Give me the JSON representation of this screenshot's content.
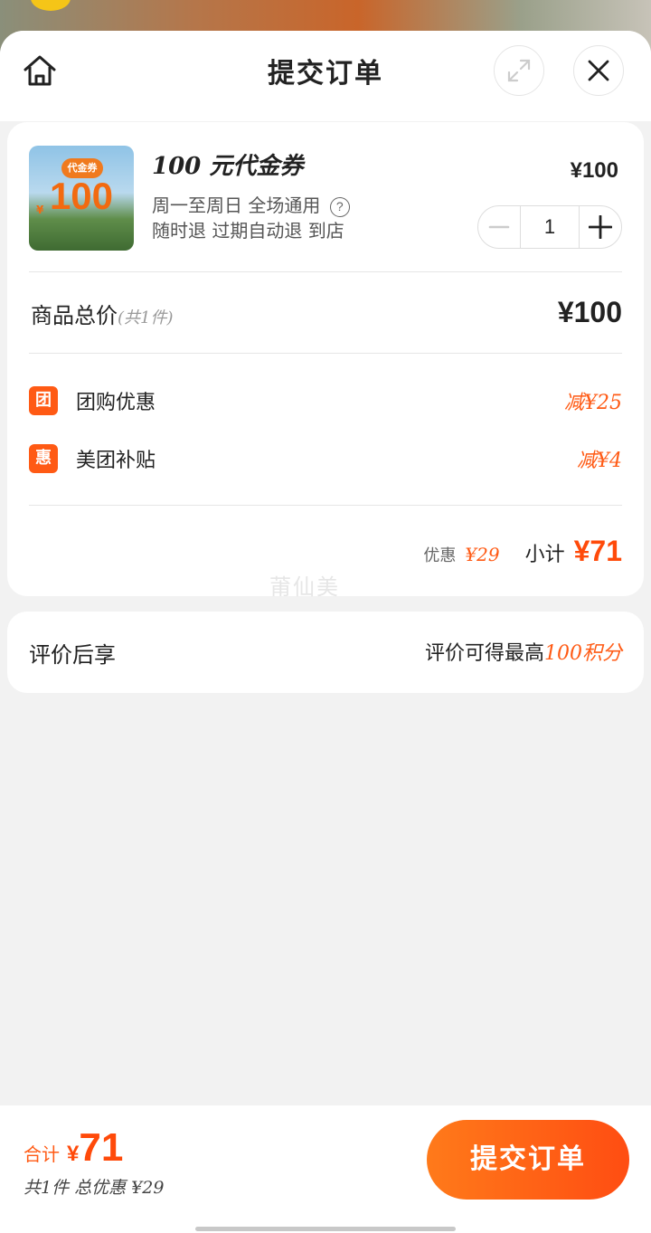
{
  "header": {
    "title": "提交订单",
    "icons": [
      "home-icon",
      "expand-icon",
      "close-icon"
    ]
  },
  "product": {
    "thumb_tag": "代金券",
    "thumb_value": "100",
    "thumb_currency": "¥",
    "name": "100 元代金券",
    "desc_line1": "周一至周日 全场通用",
    "desc_line2": "随时退 过期自动退 到店",
    "help_glyph": "?",
    "price": "¥100",
    "quantity": "1"
  },
  "summary": {
    "total_label": "商品总价",
    "total_count": "(共1件)",
    "total_price": "¥100",
    "discounts": [
      {
        "badge": "团",
        "label": "团购优惠",
        "value": "减¥25"
      },
      {
        "badge": "惠",
        "label": "美团补贴",
        "value": "减¥4"
      }
    ],
    "discount_label": "优惠",
    "discount_value": "¥29",
    "subtotal_label": "小计",
    "subtotal_value": "¥71"
  },
  "watermark": "莆仙美",
  "review": {
    "left": "评价后享",
    "right_prefix": "评价可得最高",
    "right_highlight": "100积分"
  },
  "bottom": {
    "total_label": "合计",
    "currency": "¥",
    "amount": "71",
    "sub": "共1件 总优惠 ¥29",
    "submit_label": "提交订单"
  },
  "colors": {
    "accent": "#ff5a14",
    "background": "#f2f2f2"
  }
}
